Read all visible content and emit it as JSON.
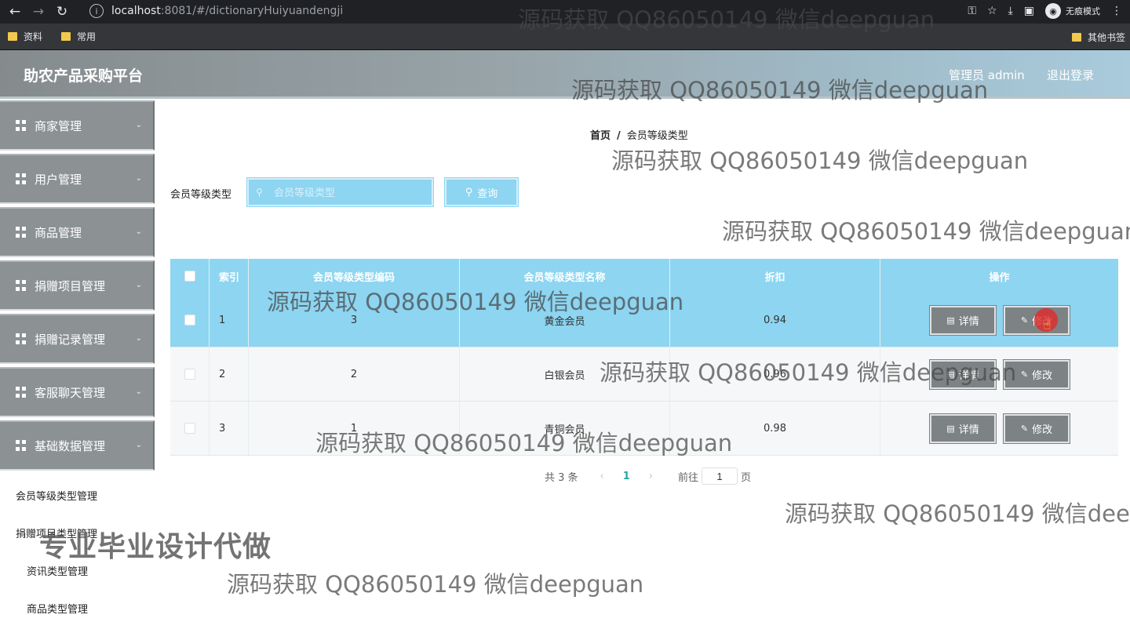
{
  "browser": {
    "url_host": "localhost",
    "url_port": ":8081",
    "url_path": "/#/dictionaryHuiyuandengji",
    "incognito_label": "无痕模式",
    "bookmarks": [
      "资料",
      "常用"
    ],
    "other_bookmarks": "其他书签"
  },
  "header": {
    "title": "助农产品采购平台",
    "user": "管理员 admin",
    "logout": "退出登录"
  },
  "sidebar": {
    "items": [
      {
        "label": "商家管理",
        "icon": "shop-icon"
      },
      {
        "label": "用户管理",
        "icon": "grid-icon"
      },
      {
        "label": "商品管理",
        "icon": "clipboard-icon"
      },
      {
        "label": "捐赠项目管理",
        "icon": "grid-icon"
      },
      {
        "label": "捐赠记录管理",
        "icon": "grid-icon"
      },
      {
        "label": "客服聊天管理",
        "icon": "grid-icon"
      },
      {
        "label": "基础数据管理",
        "icon": "grid-icon"
      }
    ],
    "subitems": [
      "会员等级类型管理",
      "捐赠项目类型管理",
      "资讯类型管理",
      "商品类型管理"
    ]
  },
  "breadcrumb": {
    "home": "首页",
    "sep": "/",
    "current": "会员等级类型"
  },
  "search": {
    "label": "会员等级类型",
    "placeholder": "会员等级类型",
    "button": "查询"
  },
  "table": {
    "headers": [
      "索引",
      "会员等级类型编码",
      "会员等级类型名称",
      "折扣",
      "操作"
    ],
    "rows": [
      {
        "index": "1",
        "code": "3",
        "name": "黄金会员",
        "discount": "0.94",
        "detail": "详情",
        "edit": "修改"
      },
      {
        "index": "2",
        "code": "2",
        "name": "白银会员",
        "discount": "0.96",
        "detail": "详情",
        "edit": "修改"
      },
      {
        "index": "3",
        "code": "1",
        "name": "青铜会员",
        "discount": "0.98",
        "detail": "详情",
        "edit": "修改"
      }
    ]
  },
  "pagination": {
    "total": "共 3 条",
    "current": "1",
    "goto": "前往",
    "page_value": "1",
    "page_unit": "页"
  },
  "watermark": {
    "text": "源码获取 QQ86050149 微信deepguan",
    "text_cut1": "源码获取 QQ86050149 微信deepguan",
    "text_cut2": "源码获取 QQ86050149 微信dee",
    "promo": "专业毕业设计代做"
  },
  "colors": {
    "accent": "#8dd5f1",
    "sidebar": "#8c9294",
    "button": "#7d8284",
    "page_active": "#2fa5a0"
  }
}
